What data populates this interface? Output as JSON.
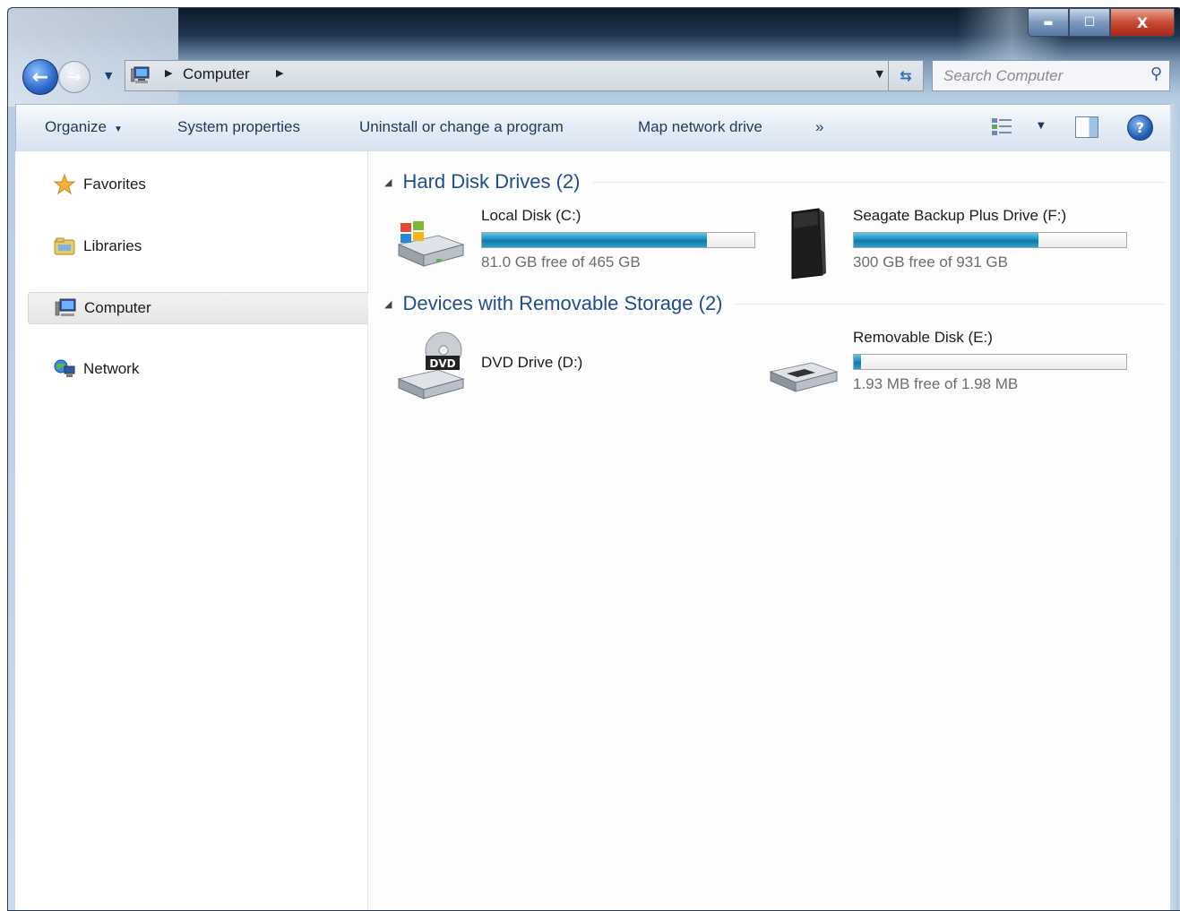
{
  "window": {
    "caption_buttons": {
      "minimize": "▬",
      "maximize": "☐",
      "close": "X"
    }
  },
  "address_bar": {
    "crumbs": [
      "Computer"
    ],
    "search_placeholder": "Search Computer"
  },
  "toolbar": {
    "organize": "Organize",
    "system_properties": "System properties",
    "uninstall": "Uninstall or change a program",
    "map_drive": "Map network drive",
    "more": "»",
    "help": "?"
  },
  "nav_pane": {
    "items": [
      {
        "label": "Favorites",
        "icon": "star-icon"
      },
      {
        "label": "Libraries",
        "icon": "libraries-icon"
      },
      {
        "label": "Computer",
        "icon": "computer-icon",
        "selected": true
      },
      {
        "label": "Network",
        "icon": "network-icon"
      }
    ]
  },
  "groups": [
    {
      "title": "Hard Disk Drives (2)",
      "drives": [
        {
          "name": "Local Disk (C:)",
          "free_text": "81.0 GB free of 465 GB",
          "used_fraction": 0.826,
          "icon": "windows-hdd-icon"
        },
        {
          "name": "Seagate Backup Plus Drive (F:)",
          "free_text": "300 GB free of 931 GB",
          "used_fraction": 0.678,
          "icon": "external-drive-icon"
        }
      ]
    },
    {
      "title": "Devices with Removable Storage (2)",
      "drives": [
        {
          "name": "DVD Drive (D:)",
          "icon": "dvd-drive-icon",
          "badge": "DVD"
        },
        {
          "name": "Removable Disk (E:)",
          "free_text": "1.93 MB free of 1.98 MB",
          "used_fraction": 0.025,
          "icon": "removable-disk-icon"
        }
      ]
    }
  ],
  "colors": {
    "group_title": "#1e4e8f",
    "bar_fill": "#1c8ec3",
    "free_text": "#6d6d6d"
  }
}
